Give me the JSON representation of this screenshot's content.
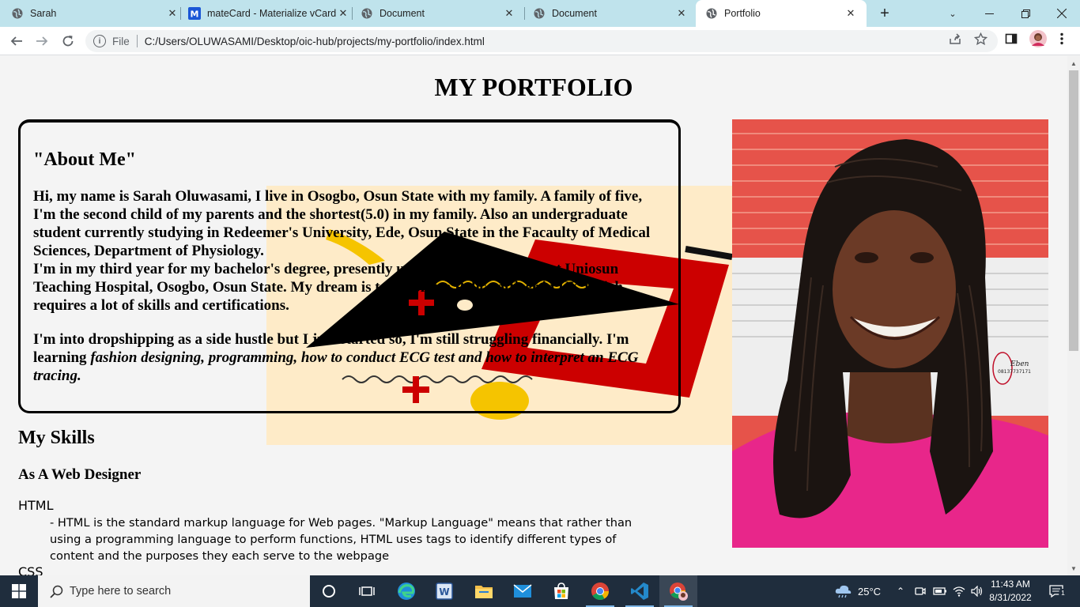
{
  "browser": {
    "tabs": [
      {
        "title": "Sarah",
        "icon": "globe-icon",
        "active": false
      },
      {
        "title": "mateCard - Materialize vCard",
        "icon": "materialize-m-icon",
        "active": false
      },
      {
        "title": "Document",
        "icon": "globe-icon",
        "active": false
      },
      {
        "title": "Document",
        "icon": "globe-icon",
        "active": false
      },
      {
        "title": "Portfolio",
        "icon": "globe-icon",
        "active": true
      }
    ],
    "new_tab": "+",
    "address": {
      "scheme": "File",
      "url": "C:/Users/OLUWASAMI/Desktop/oic-hub/projects/my-portfolio/index.html"
    }
  },
  "page": {
    "title": "MY PORTFOLIO",
    "about": {
      "heading": "\"About Me\"",
      "paragraph1": "Hi, my name is Sarah Oluwasami, I live in Osogbo, Osun State with my family. A family of five, I'm the second child of my parents and the shortest(5.0) in my family. Also an undergraduate student currently studying in Redeemer's University, Ede, Osun State in the Facaulty of Medical Sciences, Department of Physiology.",
      "paragraph1b": "I'm in my third year for my bachelor's degree, presently undergoing my SIWES at Uniosun Teaching Hospital, Osogbo, Osun State. My dream is to become a Police officer in UK which requires a lot of skills and certifications.",
      "paragraph2_lead": "I'm into dropshipping as a side hustle but I just started so, I'm still struggling financially. I'm learning ",
      "paragraph2_italic": "fashion designing, programming, how to conduct ECG test and how to interpret an ECG tracing."
    },
    "photo_watermark": {
      "name": "Eben",
      "phone": "08137737171"
    },
    "skills": {
      "heading": "My Skills",
      "subheading": "As A Web Designer",
      "items": [
        {
          "name": "HTML",
          "description": "- HTML is the standard markup language for Web pages. \"Markup Language\" means that rather than using a programming language to perform functions, HTML uses tags to identify different types of content and the purposes they each serve to the webpage"
        },
        {
          "name": "CSS"
        }
      ]
    }
  },
  "taskbar": {
    "search_placeholder": "Type here to search",
    "weather": "25°C",
    "time": "11:43 AM",
    "date": "8/31/2022",
    "notification_count": "1"
  },
  "colors": {
    "tabstrip": "#bfe3ec",
    "page_bg": "#f4f4f4",
    "art_bg": "#feebc8",
    "art_red": "#cc0000",
    "art_yellow": "#f5c400",
    "photo_shirt": "#e8268a",
    "taskbar": "#1f2d3d"
  }
}
